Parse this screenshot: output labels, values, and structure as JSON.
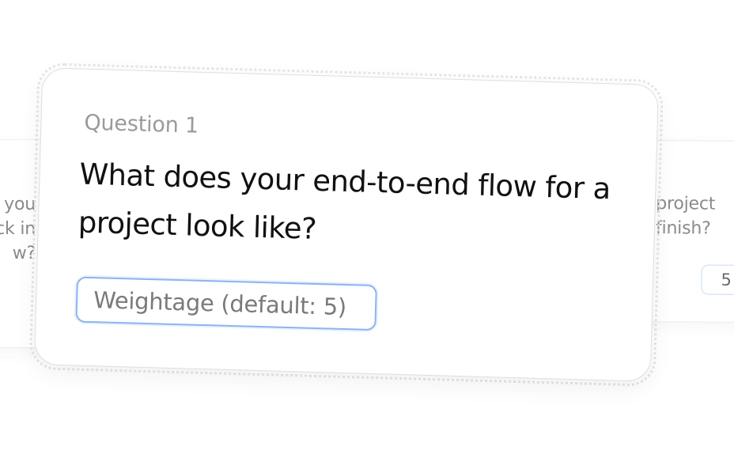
{
  "left_card": {
    "text": "you\nck in\nw?"
  },
  "main_card": {
    "question_label": "Question 1",
    "question_text": "What does your end-to-end flow for a project look like?",
    "weightage_placeholder": "Weightage (default: 5)"
  },
  "right_card": {
    "text": "project\nfinish?",
    "weightage_value": "5"
  },
  "colors": {
    "input_border": "#8db4ee",
    "muted_text": "#9a9a9a",
    "primary_text": "#111111"
  }
}
